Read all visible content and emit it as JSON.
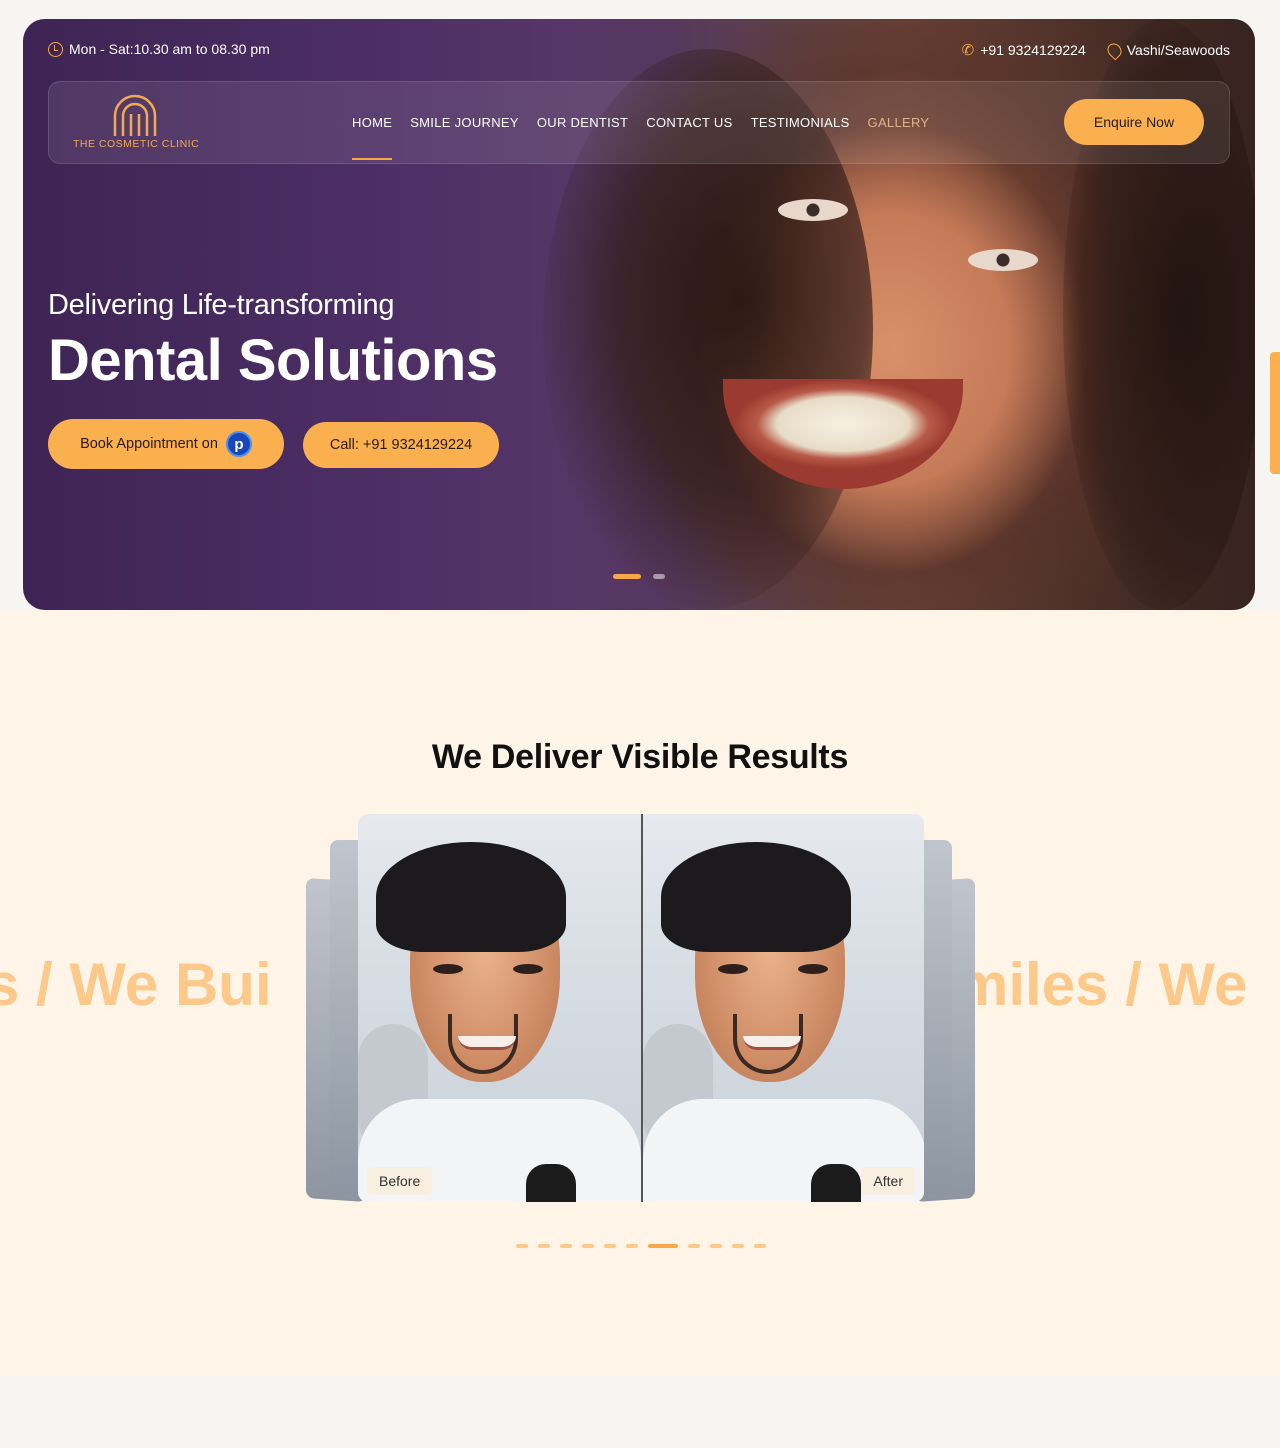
{
  "topbar": {
    "hours": "Mon - Sat:10.30 am to 08.30 pm",
    "phone": "+91 9324129224",
    "location": "Vashi/Seawoods"
  },
  "logo": {
    "text": "THE  COSMETIC  CLINIC"
  },
  "nav": {
    "items": [
      "HOME",
      "SMILE JOURNEY",
      "OUR DENTIST",
      "CONTACT US",
      "TESTIMONIALS",
      "GALLERY"
    ],
    "cta": "Enquire Now"
  },
  "hero": {
    "subtitle": "Delivering Life-transforming",
    "title": "Dental Solutions",
    "book_label": "Book Appointment on",
    "book_badge": "p",
    "call_label": "Call: +91 9324129224"
  },
  "results": {
    "title": "We Deliver Visible Results",
    "marquee_left": "s  /  We Bui",
    "marquee_right": "miles  /  We",
    "before_label": "Before",
    "after_label": "After"
  },
  "colors": {
    "accent": "#fbb050",
    "hero_bg": "#4d2f66",
    "section_bg": "#fef5e8"
  },
  "icons": {
    "hours": "clock-icon",
    "phone": "phone-icon",
    "location": "map-pin-icon"
  }
}
